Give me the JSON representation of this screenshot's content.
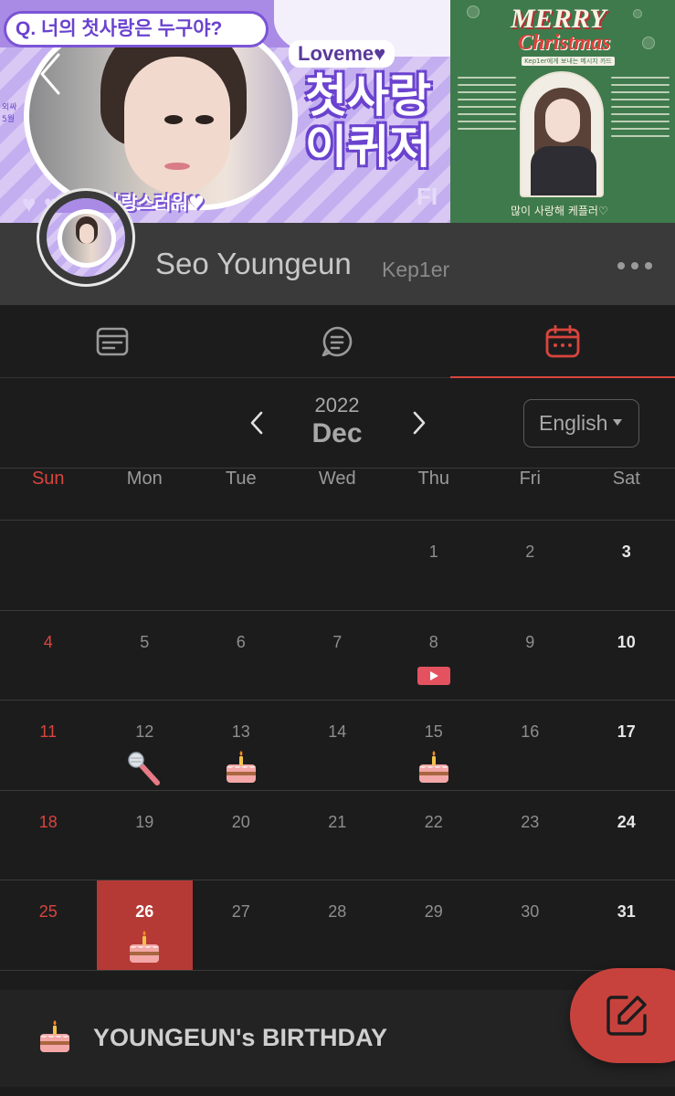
{
  "banner": {
    "question": "Q. 너의 첫사랑은 누구야?",
    "loveme": "Loveme♥",
    "headline_line1": "첫사랑",
    "headline_line2": "이퀴저",
    "tagline": "사랑스러워♥",
    "side_text": "외싸 5월",
    "corner_mark": "FI",
    "xmas_title_1": "MERRY",
    "xmas_title_2": "Christmas",
    "xmas_subtitle": "Kep1er에게 보내는 메시지 카드",
    "xmas_footer": "많이 사랑해 케플러♡"
  },
  "profile": {
    "name": "Seo Youngeun",
    "group": "Kep1er"
  },
  "tabs": [
    {
      "name": "feed",
      "icon": "list-card-icon",
      "active": false
    },
    {
      "name": "chat",
      "icon": "chat-bubble-icon",
      "active": false
    },
    {
      "name": "calendar",
      "icon": "calendar-icon",
      "active": true
    }
  ],
  "calendar": {
    "year": "2022",
    "month": "Dec",
    "language": "English",
    "weekdays": [
      "Sun",
      "Mon",
      "Tue",
      "Wed",
      "Thu",
      "Fri",
      "Sat"
    ],
    "weeks": [
      [
        {
          "d": ""
        },
        {
          "d": ""
        },
        {
          "d": ""
        },
        {
          "d": ""
        },
        {
          "d": "1"
        },
        {
          "d": "2"
        },
        {
          "d": "3"
        }
      ],
      [
        {
          "d": "4"
        },
        {
          "d": "5"
        },
        {
          "d": "6"
        },
        {
          "d": "7"
        },
        {
          "d": "8",
          "event": "youtube-icon"
        },
        {
          "d": "9"
        },
        {
          "d": "10"
        }
      ],
      [
        {
          "d": "11"
        },
        {
          "d": "12",
          "event": "microphone-icon"
        },
        {
          "d": "13",
          "event": "cake-icon"
        },
        {
          "d": "14"
        },
        {
          "d": "15",
          "event": "cake-icon"
        },
        {
          "d": "16"
        },
        {
          "d": "17"
        }
      ],
      [
        {
          "d": "18"
        },
        {
          "d": "19"
        },
        {
          "d": "20"
        },
        {
          "d": "21"
        },
        {
          "d": "22"
        },
        {
          "d": "23"
        },
        {
          "d": "24"
        }
      ],
      [
        {
          "d": "25"
        },
        {
          "d": "26",
          "event": "cake-icon",
          "selected": true
        },
        {
          "d": "27"
        },
        {
          "d": "28"
        },
        {
          "d": "29"
        },
        {
          "d": "30"
        },
        {
          "d": "31"
        }
      ]
    ]
  },
  "selected_event": {
    "icon": "cake-icon",
    "title": "YOUNGEUN's BIRTHDAY"
  },
  "colors": {
    "accent": "#d9453d",
    "today_bg": "#b53a36",
    "background": "#1c1c1d",
    "profile_bg": "#3a3a3b"
  }
}
